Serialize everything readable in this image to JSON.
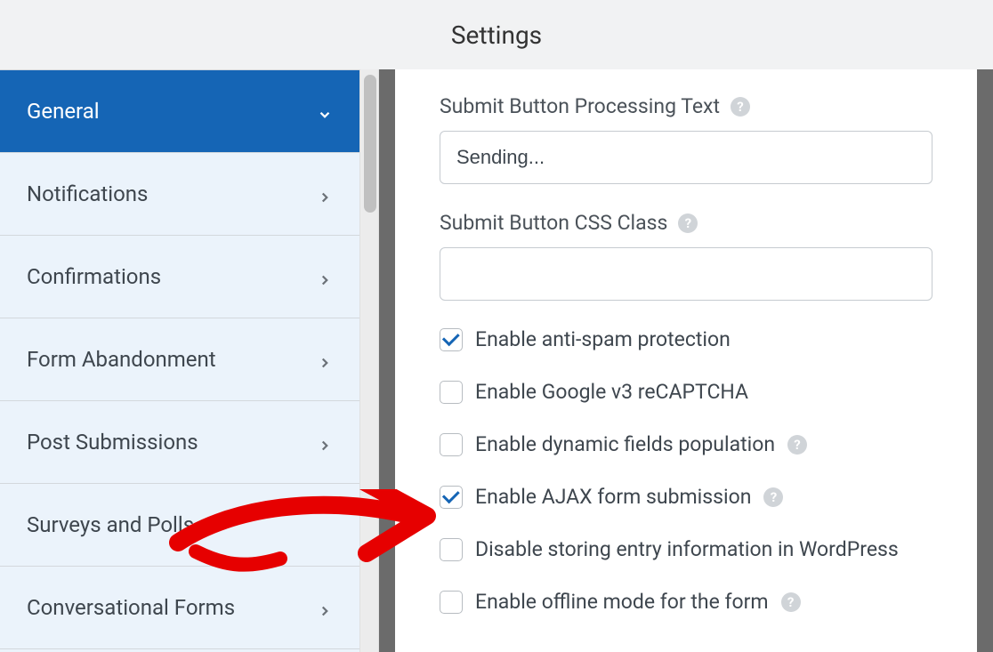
{
  "header": {
    "title": "Settings"
  },
  "sidebar": {
    "items": [
      {
        "label": "General",
        "active": true,
        "expand": "down"
      },
      {
        "label": "Notifications",
        "active": false,
        "expand": "right"
      },
      {
        "label": "Confirmations",
        "active": false,
        "expand": "right"
      },
      {
        "label": "Form Abandonment",
        "active": false,
        "expand": "right"
      },
      {
        "label": "Post Submissions",
        "active": false,
        "expand": "right"
      },
      {
        "label": "Surveys and Polls",
        "active": false,
        "expand": "none"
      },
      {
        "label": "Conversational Forms",
        "active": false,
        "expand": "right"
      }
    ]
  },
  "form": {
    "processing_text": {
      "label": "Submit Button Processing Text",
      "value": "Sending...",
      "has_help": true
    },
    "css_class": {
      "label": "Submit Button CSS Class",
      "value": "",
      "has_help": true
    },
    "checks": [
      {
        "label": "Enable anti-spam protection",
        "checked": true,
        "has_help": false
      },
      {
        "label": "Enable Google v3 reCAPTCHA",
        "checked": false,
        "has_help": false
      },
      {
        "label": "Enable dynamic fields population",
        "checked": false,
        "has_help": true
      },
      {
        "label": "Enable AJAX form submission",
        "checked": true,
        "has_help": true
      },
      {
        "label": "Disable storing entry information in WordPress",
        "checked": false,
        "has_help": false
      },
      {
        "label": "Enable offline mode for the form",
        "checked": false,
        "has_help": true
      }
    ]
  }
}
